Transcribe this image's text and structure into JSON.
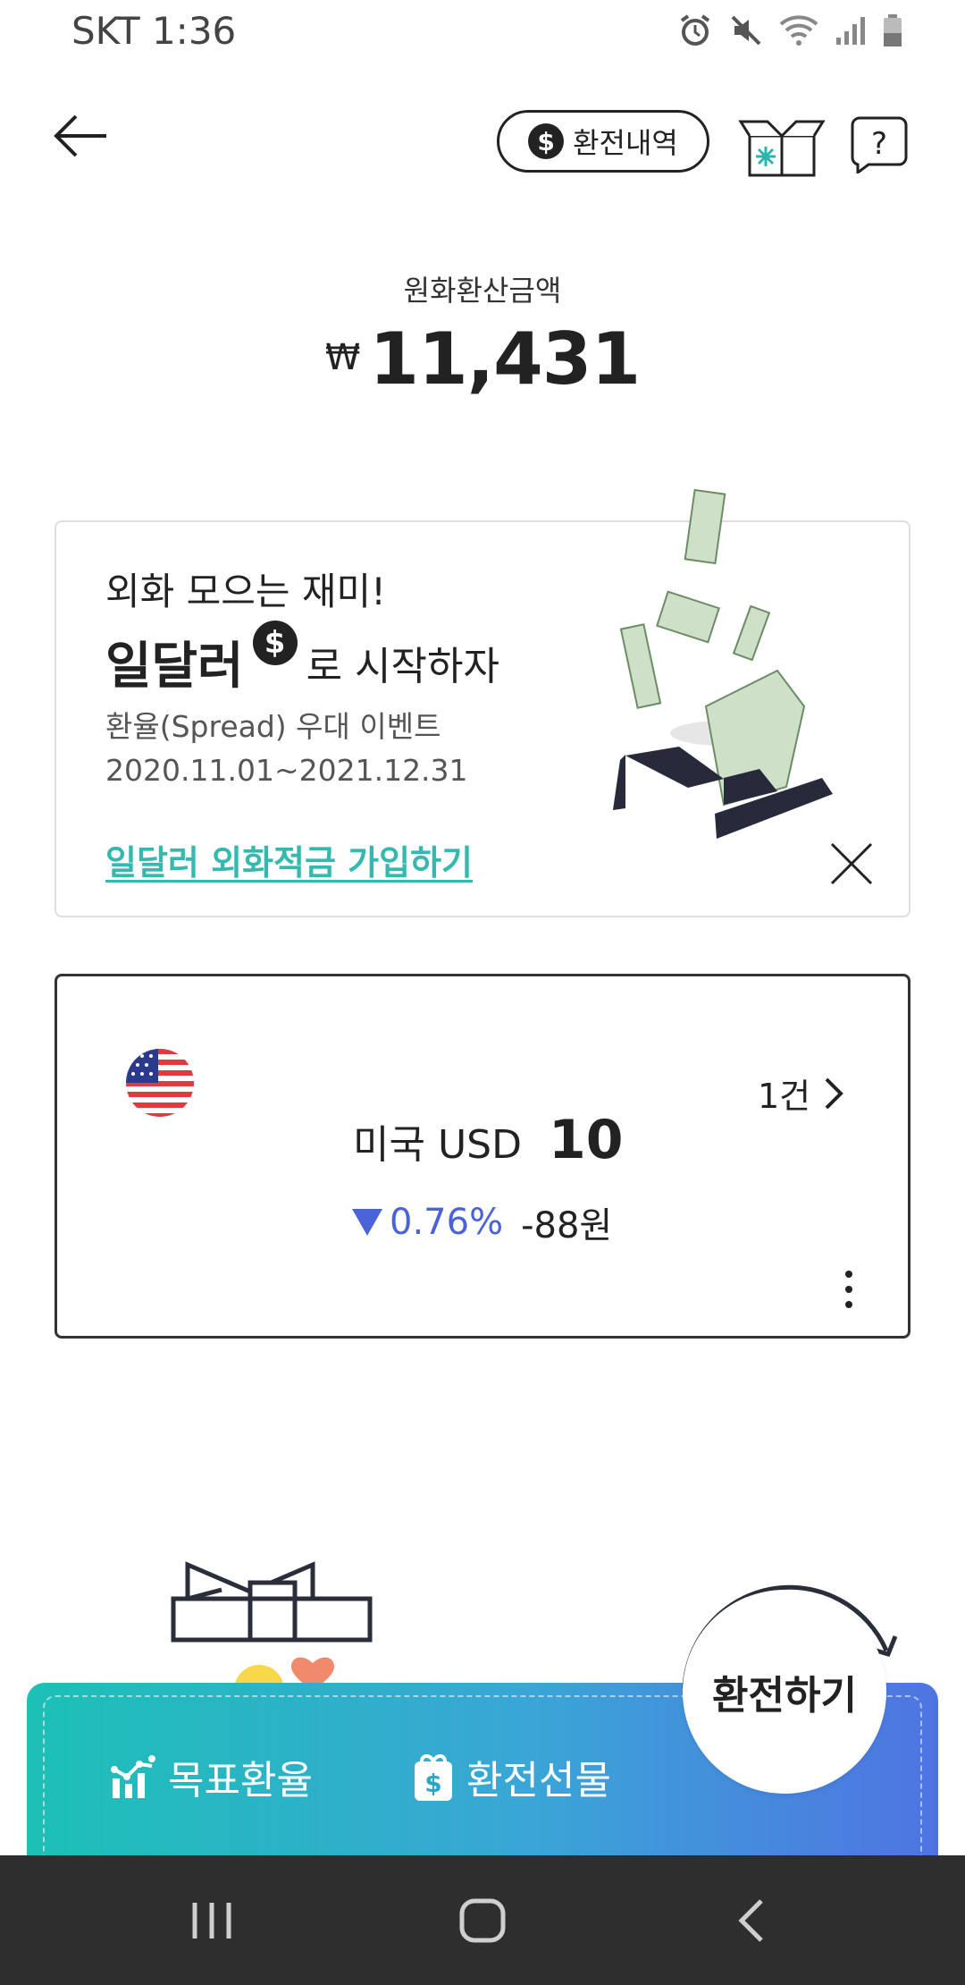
{
  "status_bar": {
    "carrier_time": "SKT 1:36"
  },
  "header": {
    "history_label": "환전내역"
  },
  "amount": {
    "label": "원화환산금액",
    "currency_symbol": "₩",
    "value": "11,431"
  },
  "promo": {
    "line1": "외화 모으는 재미!",
    "brand": "일달러",
    "coin_symbol": "$",
    "line2_rest": "로 시작하자",
    "line3": "환율(Spread) 우대 이벤트",
    "period": "2020.11.01~2021.12.31",
    "link": "일달러 외화적금 가입하기"
  },
  "currency_card": {
    "count": "1건",
    "name": "미국 USD",
    "amount": "10",
    "change_pct": "0.76%",
    "change_won": "-88원"
  },
  "actions": {
    "target_rate": "목표환율",
    "gift": "환전선물",
    "exchange": "환전하기"
  },
  "colors": {
    "accent": "#35b9ae",
    "down": "#4a63d9",
    "gradient_start": "#1cc0b6",
    "gradient_end": "#4f74e2"
  }
}
